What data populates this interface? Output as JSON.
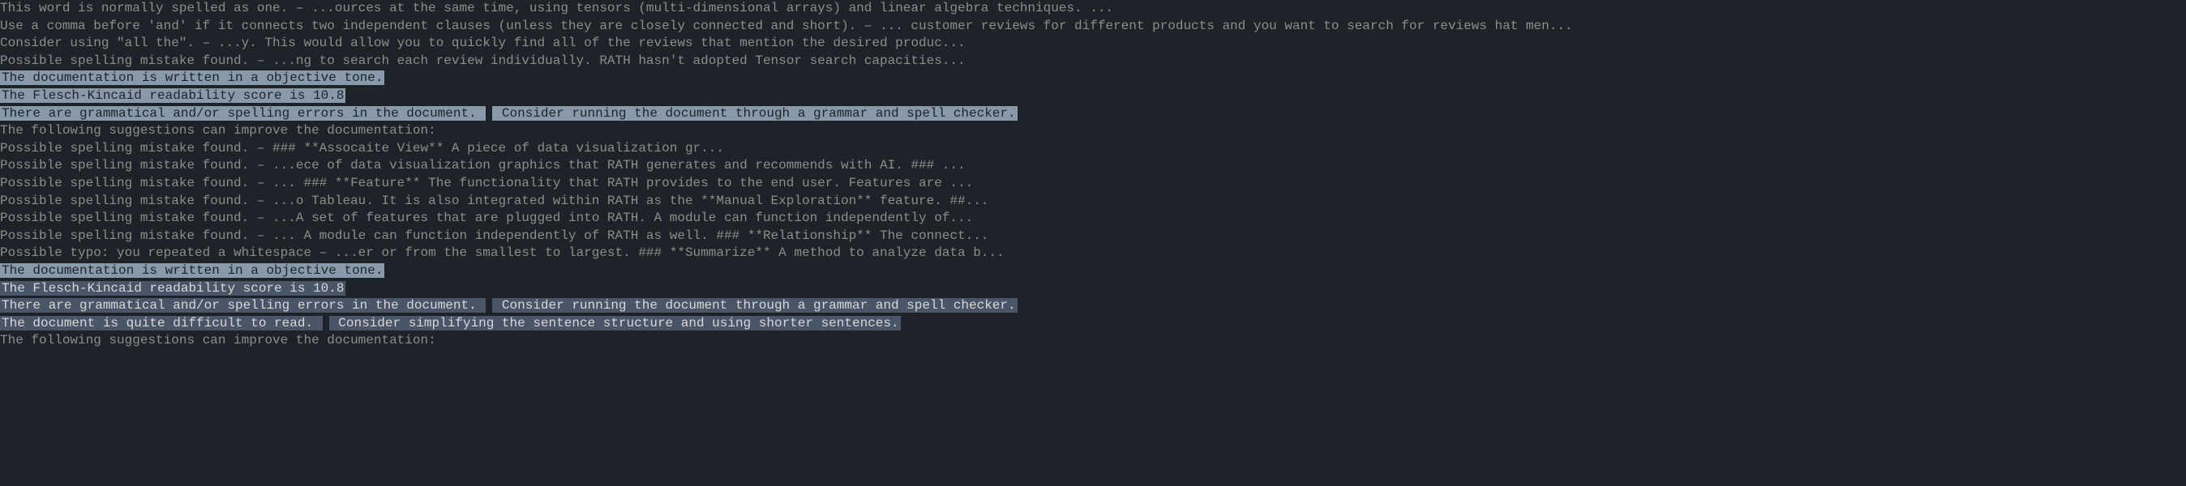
{
  "lines": [
    {
      "type": "plain",
      "text": "This word is normally spelled as one. – ...ources at the same time, using tensors (multi-dimensional arrays) and linear algebra techniques. ..."
    },
    {
      "type": "plain",
      "text": "Use a comma before 'and' if it connects two independent clauses (unless they are closely connected and short). – ... customer reviews for different products and you want to search for reviews hat men..."
    },
    {
      "type": "plain",
      "text": "Consider using \"all the\". – ...y. This would allow you to quickly find all of the reviews that mention the desired produc..."
    },
    {
      "type": "plain",
      "text": "Possible spelling mistake found. – ...ng to search each review individually.  RATH hasn't adopted Tensor search capacities..."
    },
    {
      "type": "hl-light",
      "text": " The documentation is written in a objective tone. "
    },
    {
      "type": "hl-light",
      "text": " The Flesch-Kincaid readability score is 10.8 "
    },
    {
      "type": "hl-pair",
      "a": " There are grammatical and/or spelling errors in the document. ",
      "b": " Consider running the document through a grammar and spell checker. "
    },
    {
      "type": "plain",
      "text": "The following suggestions can improve the documentation:"
    },
    {
      "type": "plain",
      "text": "Possible spelling mistake found. – ### **Assocaite View** A piece of data visualization gr..."
    },
    {
      "type": "plain",
      "text": "Possible spelling mistake found. – ...ece of data visualization graphics that RATH generates and recommends with AI.  ### ..."
    },
    {
      "type": "plain",
      "text": "Possible spelling mistake found. – ... ### **Feature** The functionality that RATH provides to the end user. Features are ..."
    },
    {
      "type": "plain",
      "text": "Possible spelling mistake found. – ...o Tableau. It is also integrated within RATH as the **Manual Exploration** feature.  ##..."
    },
    {
      "type": "plain",
      "text": "Possible spelling mistake found. – ...A set of features that are plugged into RATH. A module can function independently of..."
    },
    {
      "type": "plain",
      "text": "Possible spelling mistake found. – ... A module can function independently of RATH as well.  ### **Relationship** The connect..."
    },
    {
      "type": "plain",
      "text": "Possible typo: you repeated a whitespace – ...er or from the smallest to largest.  ###  **Summarize** A method to analyze data b..."
    },
    {
      "type": "hl-light",
      "text": " The documentation is written in a objective tone. "
    },
    {
      "type": "hl",
      "text": " The Flesch-Kincaid readability score is 10.8 "
    },
    {
      "type": "hl-pair-dark",
      "a": " There are grammatical and/or spelling errors in the document. ",
      "b": " Consider running the document through a grammar and spell checker. "
    },
    {
      "type": "hl-pair-dark",
      "a": " The document is quite difficult to read. ",
      "b": " Consider simplifying the sentence structure and using shorter sentences. "
    },
    {
      "type": "plain",
      "text": "The following suggestions can improve the documentation:"
    }
  ]
}
